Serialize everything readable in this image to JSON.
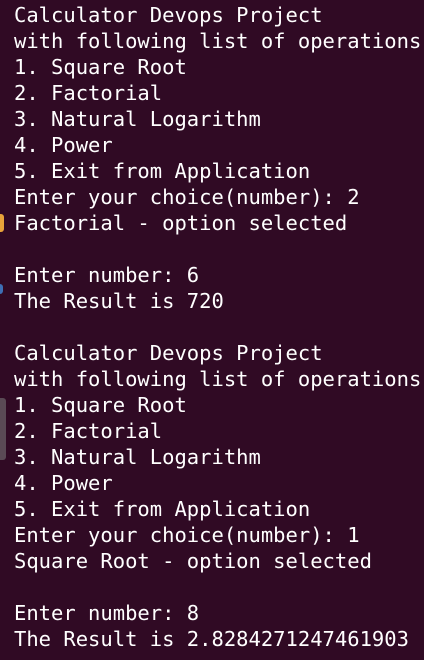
{
  "terminal": {
    "lines": [
      "Calculator Devops Project",
      "with following list of operations",
      "1. Square Root",
      "2. Factorial",
      "3. Natural Logarithm",
      "4. Power",
      "5. Exit from Application",
      "Enter your choice(number): 2",
      "Factorial - option selected",
      "",
      "Enter number: 6",
      "The Result is 720",
      "",
      "Calculator Devops Project",
      "with following list of operations",
      "1. Square Root",
      "2. Factorial",
      "3. Natural Logarithm",
      "4. Power",
      "5. Exit from Application",
      "Enter your choice(number): 1",
      "Square Root - option selected",
      "",
      "Enter number: 8",
      "The Result is 2.8284271247461903"
    ]
  },
  "colors": {
    "background": "#300a24",
    "text": "#ffffff",
    "gutter_orange": "#e8a33a",
    "gutter_blue": "#3d6fb5"
  }
}
